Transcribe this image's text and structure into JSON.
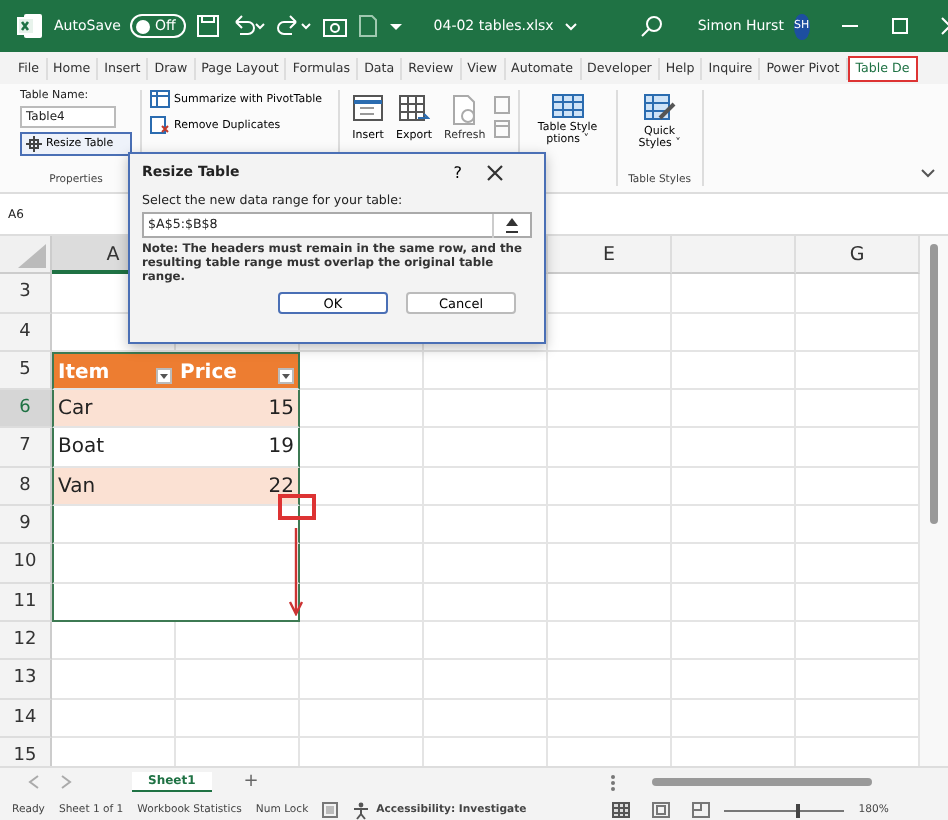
{
  "title_bar": {
    "autosave_label": "AutoSave",
    "autosave_on": false,
    "autosave_state": "Off",
    "file_name": "04-02 tables.xlsx",
    "user_name": "Simon Hurst",
    "user_initials": "SH"
  },
  "ribbon_tabs": [
    {
      "label": "File",
      "selected": false
    },
    {
      "label": "Home",
      "selected": false
    },
    {
      "label": "Insert",
      "selected": false
    },
    {
      "label": "Draw",
      "selected": false
    },
    {
      "label": "Page Layout",
      "selected": false
    },
    {
      "label": "Formulas",
      "selected": false
    },
    {
      "label": "Data",
      "selected": false
    },
    {
      "label": "Review",
      "selected": false
    },
    {
      "label": "View",
      "selected": false
    },
    {
      "label": "Automate",
      "selected": false
    },
    {
      "label": "Developer",
      "selected": false
    },
    {
      "label": "Help",
      "selected": false
    },
    {
      "label": "Inquire",
      "selected": false
    },
    {
      "label": "Power Pivot",
      "selected": false
    },
    {
      "label": "Table De",
      "selected": true
    }
  ],
  "ribbon": {
    "table_name_label": "Table Name:",
    "table_name": "Table4",
    "resize_button": "Resize Table",
    "properties_label": "Properties",
    "summarize": "Summarize with PivotTable",
    "remove_duplicates": "Remove Duplicates",
    "insert": "Insert",
    "export": "Export",
    "refresh": "Refresh",
    "style_options_1": "Table Style",
    "style_options_2": "ptions ˅",
    "quick_1": "Quick",
    "quick_2": "Styles ˅",
    "table_styles_label": "Table Styles"
  },
  "name_box": "A6",
  "columns": [
    {
      "label": "A",
      "selected": true
    },
    {
      "label": "E",
      "selected": false
    },
    {
      "label": "G",
      "selected": false
    }
  ],
  "rows": [
    {
      "number": "3",
      "selected": false,
      "kind": "plain"
    },
    {
      "number": "4",
      "selected": false,
      "kind": "plain"
    },
    {
      "number": "5",
      "selected": false,
      "kind": "table_header",
      "cells": [
        "Item",
        "Price"
      ]
    },
    {
      "number": "6",
      "selected": true,
      "kind": "table_row",
      "banded": true,
      "cells": [
        "Car",
        "15"
      ]
    },
    {
      "number": "7",
      "selected": false,
      "kind": "table_row",
      "banded": false,
      "cells": [
        "Boat",
        "19"
      ]
    },
    {
      "number": "8",
      "selected": false,
      "kind": "table_row",
      "banded": true,
      "cells": [
        "Van",
        "22"
      ]
    },
    {
      "number": "9",
      "selected": false,
      "kind": "table_empty"
    },
    {
      "number": "10",
      "selected": false,
      "kind": "table_empty"
    },
    {
      "number": "11",
      "selected": false,
      "kind": "table_end"
    },
    {
      "number": "12",
      "selected": false,
      "kind": "plain"
    },
    {
      "number": "13",
      "selected": false,
      "kind": "plain"
    },
    {
      "number": "14",
      "selected": false,
      "kind": "plain"
    },
    {
      "number": "15",
      "selected": false,
      "kind": "plain"
    }
  ],
  "dialog": {
    "title": "Resize Table",
    "help": "?",
    "prompt": "Select the new data range for your table:",
    "range": "$A$5:$B$8",
    "note": "Note: The headers must remain in the same row, and the resulting table range must overlap the original table range.",
    "buttons": [
      "OK",
      "Cancel"
    ]
  },
  "sheet_tabs": [
    {
      "label": "Sheet1",
      "selected": true
    }
  ],
  "add_sheet": "+",
  "status_bar": {
    "items": [
      "Ready",
      "Sheet 1 of 1",
      "Workbook Statistics",
      "Num Lock"
    ],
    "accessibility": "Accessibility: Investigate",
    "zoom": "180%",
    "zoom_slider": {
      "level": 0.6
    }
  }
}
